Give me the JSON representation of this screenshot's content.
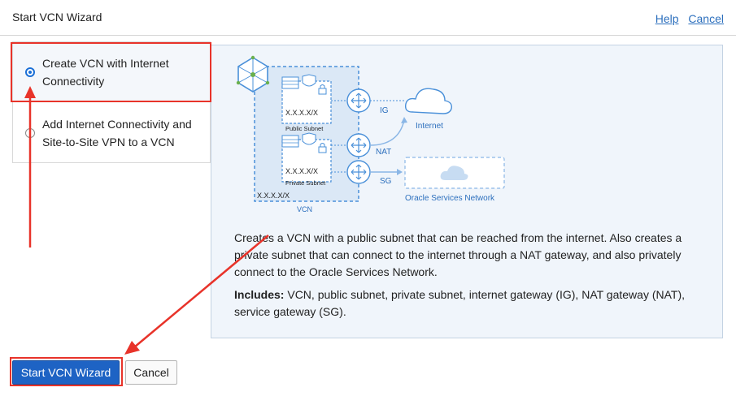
{
  "header": {
    "title": "Start VCN Wizard",
    "help_label": "Help",
    "cancel_label": "Cancel"
  },
  "options": [
    {
      "label": "Create VCN with Internet Connectivity",
      "selected": true
    },
    {
      "label": "Add Internet Connectivity and Site-to-Site VPN to a VCN",
      "selected": false
    }
  ],
  "diagram": {
    "public_subnet_label": "Public Subnet",
    "private_subnet_label": "Private Subnet",
    "cidr_public": "X.X.X.X/X",
    "cidr_private": "X.X.X.X/X",
    "cidr_vcn": "X.X.X.X/X",
    "vcn_label": "VCN",
    "ig_label": "IG",
    "nat_label": "NAT",
    "sg_label": "SG",
    "internet_label": "Internet",
    "oracle_services_label": "Oracle Services Network"
  },
  "description": "Creates a VCN with a public subnet that can be reached from the internet. Also creates a private subnet that can connect to the internet through a NAT gateway, and also privately connect to the Oracle Services Network.",
  "includes": {
    "heading": "Includes:",
    "text": " VCN, public subnet, private subnet, internet gateway (IG), NAT gateway (NAT), service gateway (SG)."
  },
  "buttons": {
    "start_label": "Start VCN Wizard",
    "cancel_label": "Cancel"
  },
  "colors": {
    "accent_blue": "#1e63c4",
    "annotation_red": "#e8332a",
    "diagram_blue": "#4a90d9"
  }
}
